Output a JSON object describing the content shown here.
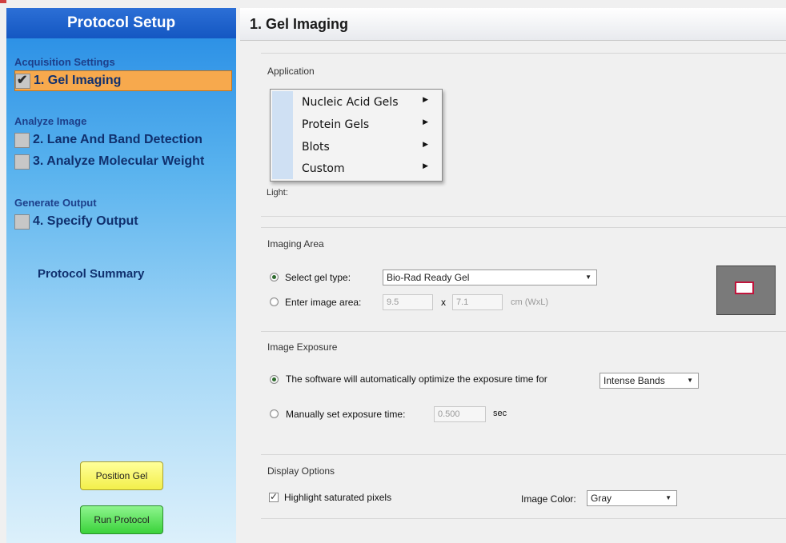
{
  "sidebar": {
    "title": "Protocol Setup",
    "groups": [
      {
        "title": "Acquisition Settings"
      },
      {
        "title": "Analyze Image"
      },
      {
        "title": "Generate Output"
      }
    ],
    "steps": [
      {
        "label": "1. Gel Imaging",
        "checked": true,
        "active": true
      },
      {
        "label": "2. Lane And Band Detection",
        "checked": false
      },
      {
        "label": "3. Analyze Molecular Weight",
        "checked": false
      },
      {
        "label": "4. Specify Output",
        "checked": false
      }
    ],
    "summary_label": "Protocol Summary",
    "position_gel_label": "Position Gel",
    "run_protocol_label": "Run Protocol"
  },
  "main": {
    "title": "1. Gel Imaging",
    "application": {
      "section_title": "Application",
      "menu_items": [
        "Nucleic Acid Gels",
        "Protein Gels",
        "Blots",
        "Custom"
      ],
      "light_label": "Light:"
    },
    "imaging_area": {
      "section_title": "Imaging Area",
      "select_gel_label": "Select gel type:",
      "gel_type_value": "Bio-Rad Ready Gel",
      "enter_area_label": "Enter image area:",
      "width_value": "9.5",
      "x_label": "x",
      "length_value": "7.1",
      "unit_label": "cm (WxL)"
    },
    "exposure": {
      "section_title": "Image Exposure",
      "auto_label": "The software will automatically optimize the exposure time for",
      "auto_value": "Intense Bands",
      "manual_label": "Manually set exposure time:",
      "manual_value": "0.500",
      "manual_unit": "sec"
    },
    "display": {
      "section_title": "Display Options",
      "highlight_label": "Highlight saturated pixels",
      "highlight_checked": true,
      "color_label": "Image Color:",
      "color_value": "Gray"
    }
  },
  "icons": {
    "check": "check-icon",
    "arrow": "triangle-right-icon",
    "dropdown": "dropdown-arrow-icon"
  },
  "colors": {
    "sidebar_top": "#1f7fd6",
    "active_step": "#f7a94d",
    "position_gel": "#f3ef4a",
    "run_protocol": "#3ad23a"
  }
}
